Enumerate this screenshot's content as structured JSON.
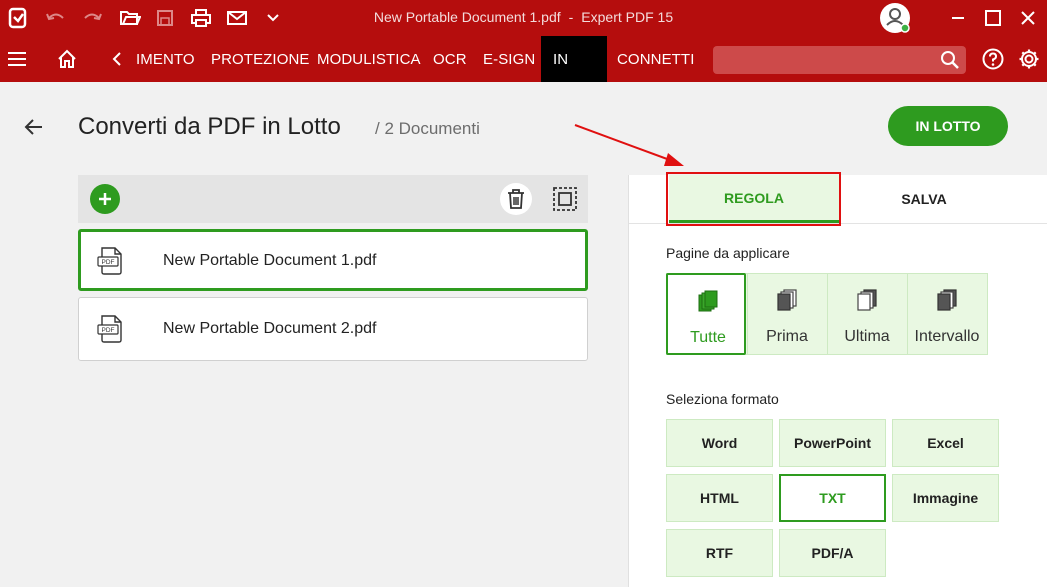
{
  "titlebar": {
    "document": "New Portable Document 1.pdf",
    "separator": "-",
    "app": "Expert PDF 15",
    "icons": [
      "app-logo-icon",
      "undo-icon",
      "redo-icon",
      "open-folder-icon",
      "save-icon",
      "print-icon",
      "mail-icon",
      "chevron-down-icon",
      "user-avatar-icon",
      "minimize-icon",
      "maximize-icon",
      "close-icon"
    ]
  },
  "ribbon": {
    "tabs": [
      "IMENTO",
      "PROTEZIONE",
      "MODULISTICA",
      "OCR",
      "E-SIGN",
      "IN",
      "CONNETTI"
    ],
    "active_tab": "IN",
    "search_placeholder": "",
    "icons": [
      "hamburger-menu-icon",
      "home-icon",
      "chevron-left-icon",
      "search-icon",
      "help-icon",
      "settings-icon"
    ]
  },
  "page": {
    "title": "Converti da PDF in Lotto",
    "subtitle": "/ 2 Documenti",
    "action_button": "IN LOTTO"
  },
  "files": [
    {
      "name": "New Portable Document 1.pdf",
      "icon_label": "PDF",
      "selected": true
    },
    {
      "name": "New Portable Document 2.pdf",
      "icon_label": "PDF",
      "selected": false
    }
  ],
  "panel": {
    "tabs": [
      "REGOLA",
      "SALVA"
    ],
    "active_tab": "REGOLA",
    "pages_label": "Pagine da applicare",
    "page_options": [
      "Tutte",
      "Prima",
      "Ultima",
      "Intervallo"
    ],
    "selected_page_option": "Tutte",
    "format_label": "Seleziona formato",
    "formats": [
      "Word",
      "PowerPoint",
      "Excel",
      "HTML",
      "TXT",
      "Immagine",
      "RTF",
      "PDF/A"
    ],
    "selected_format": "TXT"
  },
  "colors": {
    "brand_red": "#b50d0d",
    "accent_green": "#2e9b1f",
    "light_green": "#e9f8e2",
    "annotation_red": "#e01010"
  }
}
